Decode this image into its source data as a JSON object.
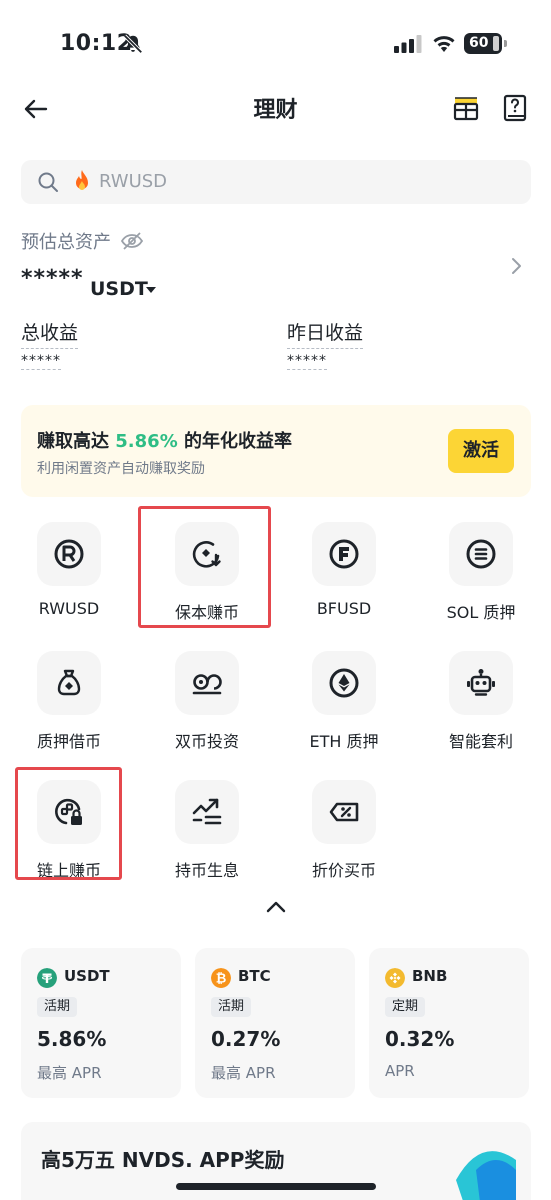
{
  "status_bar": {
    "time": "10:12",
    "battery": "60"
  },
  "nav": {
    "title": "理财"
  },
  "search": {
    "placeholder": "RWUSD"
  },
  "assets": {
    "label": "预估总资产",
    "value": "*****",
    "currency": "USDT",
    "total_earnings_label": "总收益",
    "total_earnings_value": "*****",
    "yesterday_earnings_label": "昨日收益",
    "yesterday_earnings_value": "*****"
  },
  "promo": {
    "title_prefix": "赚取高达 ",
    "title_rate": "5.86%",
    "title_suffix": " 的年化收益率",
    "subtitle": "利用闲置资产自动赚取奖励",
    "button": "激活"
  },
  "products": [
    {
      "label": "RWUSD",
      "icon": "rwusd-icon"
    },
    {
      "label": "保本赚币",
      "icon": "principal-protected-icon"
    },
    {
      "label": "BFUSD",
      "icon": "bfusd-icon"
    },
    {
      "label": "SOL 质押",
      "icon": "sol-staking-icon"
    },
    {
      "label": "质押借币",
      "icon": "loan-bag-icon"
    },
    {
      "label": "双币投资",
      "icon": "dual-investment-icon"
    },
    {
      "label": "ETH 质押",
      "icon": "eth-staking-icon"
    },
    {
      "label": "智能套利",
      "icon": "robot-icon"
    },
    {
      "label": "链上赚币",
      "icon": "onchain-lock-icon"
    },
    {
      "label": "持币生息",
      "icon": "trend-up-icon"
    },
    {
      "label": "折价买币",
      "icon": "discount-ticket-icon"
    }
  ],
  "coins": [
    {
      "name": "USDT",
      "tag": "活期",
      "rate": "5.86%",
      "apr": "最高 APR",
      "color": "#26a17b"
    },
    {
      "name": "BTC",
      "tag": "活期",
      "rate": "0.27%",
      "apr": "最高 APR",
      "color": "#f7931a"
    },
    {
      "name": "BNB",
      "tag": "定期",
      "rate": "0.32%",
      "apr": "APR",
      "color": "#f3ba2f"
    }
  ],
  "banner": {
    "text": "高5万五 NVDS. APP奖励"
  },
  "colors": {
    "accent_yellow": "#fcd535",
    "green": "#2ebd85",
    "highlight_red": "#e5484d"
  }
}
